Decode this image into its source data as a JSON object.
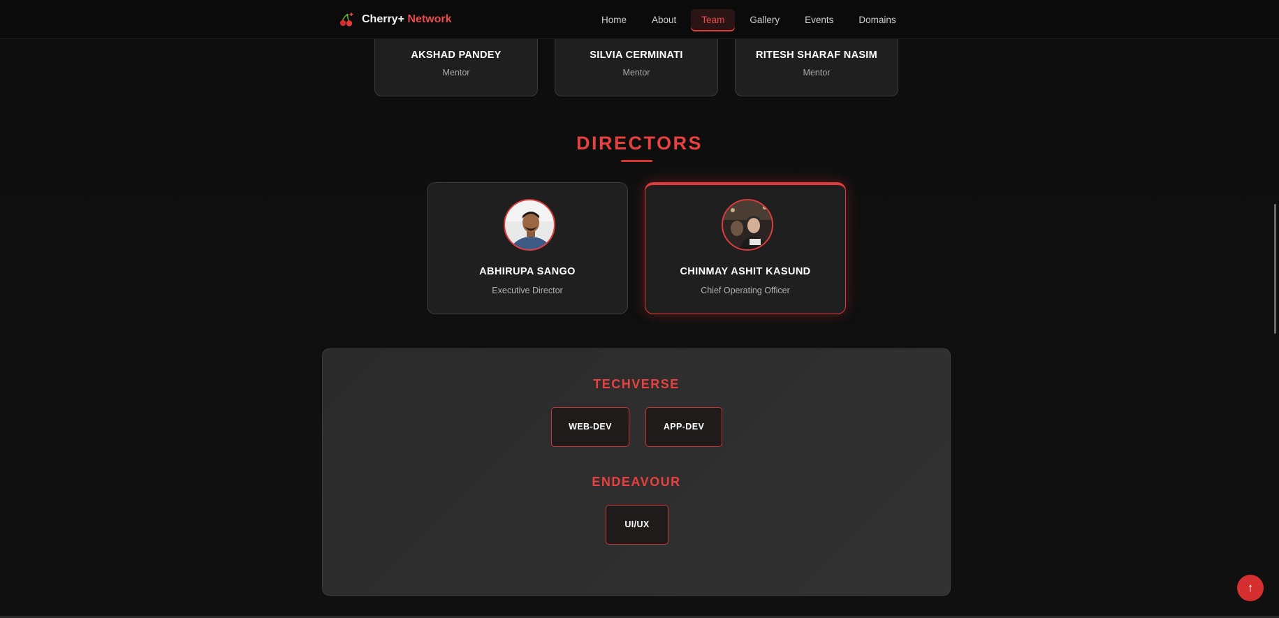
{
  "nav": {
    "brand_part1": "Cherry+",
    "brand_part2": "Network",
    "links": [
      {
        "label": "Home"
      },
      {
        "label": "About"
      },
      {
        "label": "Team",
        "active": true
      },
      {
        "label": "Gallery"
      },
      {
        "label": "Events"
      },
      {
        "label": "Domains"
      }
    ]
  },
  "mentors": [
    {
      "name": "AKSHAD PANDEY",
      "role": "Mentor"
    },
    {
      "name": "SILVIA CERMINATI",
      "role": "Mentor"
    },
    {
      "name": "RITESH SHARAF NASIM",
      "role": "Mentor"
    }
  ],
  "directors": {
    "title": "DIRECTORS",
    "members": [
      {
        "name": "ABHIRUPA SANGO",
        "role": "Executive Director"
      },
      {
        "name": "CHINMAY ASHIT KASUND",
        "role": "Chief Operating Officer"
      }
    ]
  },
  "domains": {
    "groups": [
      {
        "title": "TECHVERSE",
        "items": [
          "WEB-DEV",
          "APP-DEV"
        ]
      },
      {
        "title": "ENDEAVOUR",
        "items": [
          "UI/UX"
        ]
      }
    ]
  },
  "scroll_top_icon": "arrow-up-icon",
  "colors": {
    "accent": "#e8413f",
    "background": "#0d0d0d",
    "card": "#1f1f1f"
  }
}
